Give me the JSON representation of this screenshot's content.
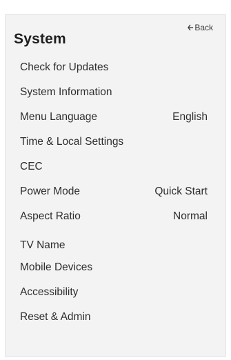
{
  "panel": {
    "title": "System",
    "back_label": "Back"
  },
  "menu": {
    "items": [
      {
        "label": "Check for Updates",
        "value": ""
      },
      {
        "label": "System Information",
        "value": ""
      },
      {
        "label": "Menu Language",
        "value": "English"
      },
      {
        "label": "Time & Local Settings",
        "value": ""
      },
      {
        "label": "CEC",
        "value": ""
      },
      {
        "label": "Power Mode",
        "value": "Quick Start"
      },
      {
        "label": "Aspect Ratio",
        "value": "Normal"
      },
      {
        "label": "TV Name",
        "value": ""
      },
      {
        "label": "Mobile Devices",
        "value": ""
      },
      {
        "label": "Accessibility",
        "value": ""
      },
      {
        "label": "Reset & Admin",
        "value": ""
      }
    ]
  }
}
